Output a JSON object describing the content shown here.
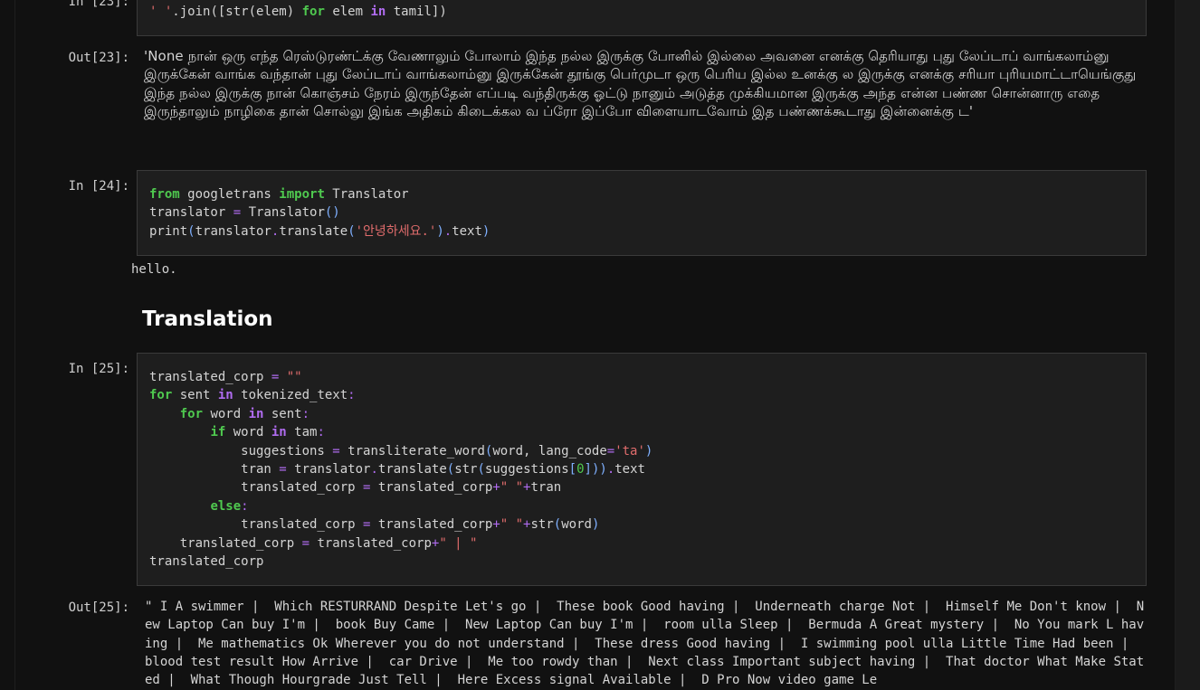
{
  "cells": {
    "in23": {
      "prompt": "In [23]:",
      "lines": [
        [
          [
            "str",
            "' '"
          ],
          [
            "plain",
            ".join([str(elem) "
          ],
          [
            "kw",
            "for"
          ],
          [
            "plain",
            " elem "
          ],
          [
            "kw2",
            "in"
          ],
          [
            "plain",
            " tamil])"
          ]
        ]
      ]
    },
    "out23": {
      "prompt": "Out[23]:",
      "text": "'None நான் ஒரு எந்த ரெஸ்டுரண்ட்க்கு வேணாலும் போலாம் இந்த நல்ல இருக்கு போனில் இல்லை அவனை எனக்கு தெரியாது புது லேப்டாப் வாங்கலாம்னு இருக்கேன் வாங்க வந்தான் புது லேப்டாப் வாங்கலாம்னு இருக்கேன் தூங்கு பெர்முடா ஒரு பெரிய இல்ல உனக்கு ல இருக்கு எனக்கு சரியா புரியமாட்டாயெங்குது இந்த நல்ல இருக்கு நான் கொஞ்சம் நேரம் இருந்தேன் எப்படி வந்திருக்கு ஓட்டு நானும் அடுத்த முக்கியமான இருக்கு அந்த என்ன பண்ண சொன்னாரு எதை இருந்தாலும் நாழிகை தான் சொல்லு இங்க அதிகம் கிடைக்கல வ ப்ரோ இப்போ விளையாடவோம் இத பண்ணக்கூடாது இன்னைக்கு ட'"
    },
    "in24": {
      "prompt": "In [24]:",
      "lines": [
        [
          [
            "kw",
            "from"
          ],
          [
            "plain",
            " googletrans "
          ],
          [
            "kw",
            "import"
          ],
          [
            "plain",
            " Translator"
          ]
        ],
        [
          [
            "plain",
            "translator "
          ],
          [
            "op",
            "="
          ],
          [
            "plain",
            " Translator"
          ],
          [
            "brk",
            "()"
          ]
        ],
        [
          [
            "plain",
            "print"
          ],
          [
            "brk",
            "("
          ],
          [
            "plain",
            "translator"
          ],
          [
            "op",
            "."
          ],
          [
            "plain",
            "translate"
          ],
          [
            "brk",
            "("
          ],
          [
            "str",
            "'안녕하세요.'"
          ],
          [
            "brk",
            ")"
          ],
          [
            "op",
            "."
          ],
          [
            "plain",
            "text"
          ],
          [
            "brk",
            ")"
          ]
        ]
      ]
    },
    "out24": {
      "text": "hello."
    },
    "heading": "Translation",
    "in25": {
      "prompt": "In [25]:",
      "lines": [
        [
          [
            "plain",
            "translated_corp "
          ],
          [
            "op",
            "="
          ],
          [
            "str",
            " \"\""
          ]
        ],
        [
          [
            "kw",
            "for"
          ],
          [
            "plain",
            " sent "
          ],
          [
            "kw2",
            "in"
          ],
          [
            "plain",
            " tokenized_text"
          ],
          [
            "op",
            ":"
          ]
        ],
        [
          [
            "plain",
            "    "
          ],
          [
            "kw",
            "for"
          ],
          [
            "plain",
            " word "
          ],
          [
            "kw2",
            "in"
          ],
          [
            "plain",
            " sent"
          ],
          [
            "op",
            ":"
          ]
        ],
        [
          [
            "plain",
            "        "
          ],
          [
            "kw",
            "if"
          ],
          [
            "plain",
            " word "
          ],
          [
            "kw2",
            "in"
          ],
          [
            "plain",
            " tam"
          ],
          [
            "op",
            ":"
          ]
        ],
        [
          [
            "plain",
            "            suggestions "
          ],
          [
            "op",
            "="
          ],
          [
            "plain",
            " transliterate_word"
          ],
          [
            "brk",
            "("
          ],
          [
            "plain",
            "word, lang_code"
          ],
          [
            "op",
            "="
          ],
          [
            "str",
            "'ta'"
          ],
          [
            "brk",
            ")"
          ]
        ],
        [
          [
            "plain",
            "            tran "
          ],
          [
            "op",
            "="
          ],
          [
            "plain",
            " translator"
          ],
          [
            "op",
            "."
          ],
          [
            "plain",
            "translate"
          ],
          [
            "brk",
            "("
          ],
          [
            "plain",
            "str"
          ],
          [
            "brk",
            "("
          ],
          [
            "plain",
            "suggestions"
          ],
          [
            "brk",
            "["
          ],
          [
            "num",
            "0"
          ],
          [
            "brk",
            "]))"
          ],
          [
            "op",
            "."
          ],
          [
            "plain",
            "text"
          ]
        ],
        [
          [
            "plain",
            "            translated_corp "
          ],
          [
            "op",
            "="
          ],
          [
            "plain",
            " translated_corp"
          ],
          [
            "op",
            "+"
          ],
          [
            "str",
            "\" \""
          ],
          [
            "op",
            "+"
          ],
          [
            "plain",
            "tran"
          ]
        ],
        [
          [
            "plain",
            "        "
          ],
          [
            "kw",
            "else"
          ],
          [
            "op",
            ":"
          ]
        ],
        [
          [
            "plain",
            "            translated_corp "
          ],
          [
            "op",
            "="
          ],
          [
            "plain",
            " translated_corp"
          ],
          [
            "op",
            "+"
          ],
          [
            "str",
            "\" \""
          ],
          [
            "op",
            "+"
          ],
          [
            "plain",
            "str"
          ],
          [
            "brk",
            "("
          ],
          [
            "plain",
            "word"
          ],
          [
            "brk",
            ")"
          ]
        ],
        [
          [
            "plain",
            "    translated_corp "
          ],
          [
            "op",
            "="
          ],
          [
            "plain",
            " translated_corp"
          ],
          [
            "op",
            "+"
          ],
          [
            "str",
            "\" | \""
          ]
        ],
        [
          [
            "plain",
            "translated_corp"
          ]
        ]
      ]
    },
    "out25": {
      "prompt": "Out[25]:",
      "text": "\" I A swimmer |  Which RESTURRAND Despite Let's go |  These book Good having |  Underneath charge Not |  Himself Me Don't know |  New Laptop Can buy I'm |  book Buy Came |  New Laptop Can buy I'm |  room ulla Sleep |  Bermuda A Great mystery |  No You mark L having |  Me mathematics Ok Wherever you do not understand |  These dress Good having |  I swimming pool ulla Little Time Had been |  blood test result How Arrive |  car Drive |  Me too rowdy than |  Next class Important subject having |  That doctor What Make Stated |  What Though Hourgrade Just Tell |  Here Excess signal Available |  D Pro Now video game Le"
    }
  }
}
